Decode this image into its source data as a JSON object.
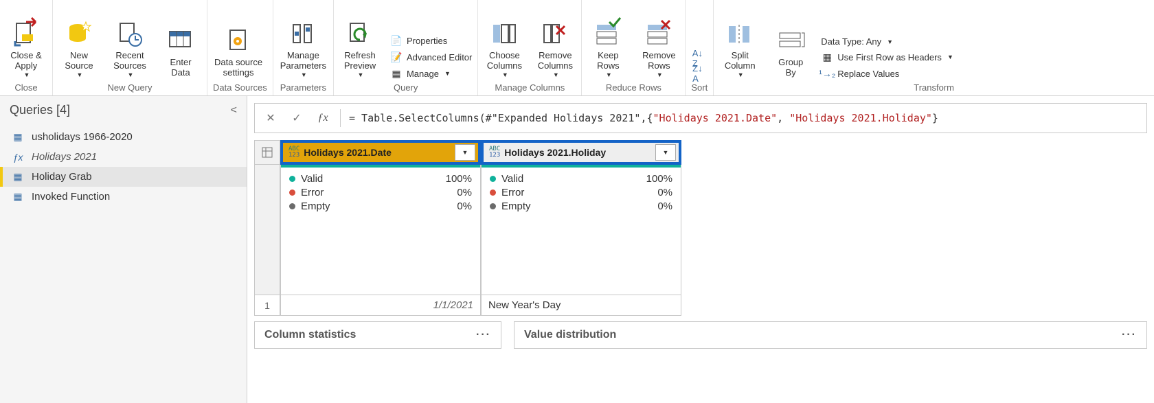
{
  "ribbon": {
    "close": {
      "close_apply": "Close &\nApply",
      "group": "Close"
    },
    "newquery": {
      "new_source": "New\nSource",
      "recent_sources": "Recent\nSources",
      "enter_data": "Enter\nData",
      "group": "New Query"
    },
    "datasources": {
      "settings": "Data source\nsettings",
      "group": "Data Sources"
    },
    "parameters": {
      "manage": "Manage\nParameters",
      "group": "Parameters"
    },
    "query": {
      "refresh": "Refresh\nPreview",
      "properties": "Properties",
      "adv_editor": "Advanced Editor",
      "manage": "Manage",
      "group": "Query"
    },
    "mc": {
      "choose": "Choose\nColumns",
      "remove": "Remove\nColumns",
      "group": "Manage Columns"
    },
    "rr": {
      "keep": "Keep\nRows",
      "remove": "Remove\nRows",
      "group": "Reduce Rows"
    },
    "sort": {
      "group": "Sort"
    },
    "transform": {
      "split": "Split\nColumn",
      "groupby": "Group\nBy",
      "datatype": "Data Type: Any",
      "headers": "Use First Row as Headers",
      "replace": "Replace Values",
      "group": "Transform"
    }
  },
  "queries": {
    "title": "Queries [4]",
    "items": [
      {
        "label": "usholidays 1966-2020",
        "kind": "table"
      },
      {
        "label": "Holidays 2021",
        "kind": "fx"
      },
      {
        "label": "Holiday Grab",
        "kind": "table",
        "selected": true
      },
      {
        "label": "Invoked Function",
        "kind": "table"
      }
    ]
  },
  "formula": {
    "prefix": "= Table.SelectColumns(#\"Expanded Holidays 2021\",{",
    "str1": "\"Holidays 2021.Date\"",
    "sep": ", ",
    "str2": "\"Holidays 2021.Holiday\"",
    "suffix": "}"
  },
  "columns": [
    {
      "name": "Holidays 2021.Date",
      "selected": true,
      "quality": {
        "valid": "100%",
        "error": "0%",
        "empty": "0%"
      }
    },
    {
      "name": "Holidays 2021.Holiday",
      "selected": false,
      "quality": {
        "valid": "100%",
        "error": "0%",
        "empty": "0%"
      }
    }
  ],
  "quality_labels": {
    "valid": "Valid",
    "error": "Error",
    "empty": "Empty"
  },
  "rows": [
    {
      "idx": "1",
      "c0": "1/1/2021",
      "c1": "New Year's Day"
    }
  ],
  "bottom": {
    "col_stats": "Column statistics",
    "val_dist": "Value distribution"
  }
}
